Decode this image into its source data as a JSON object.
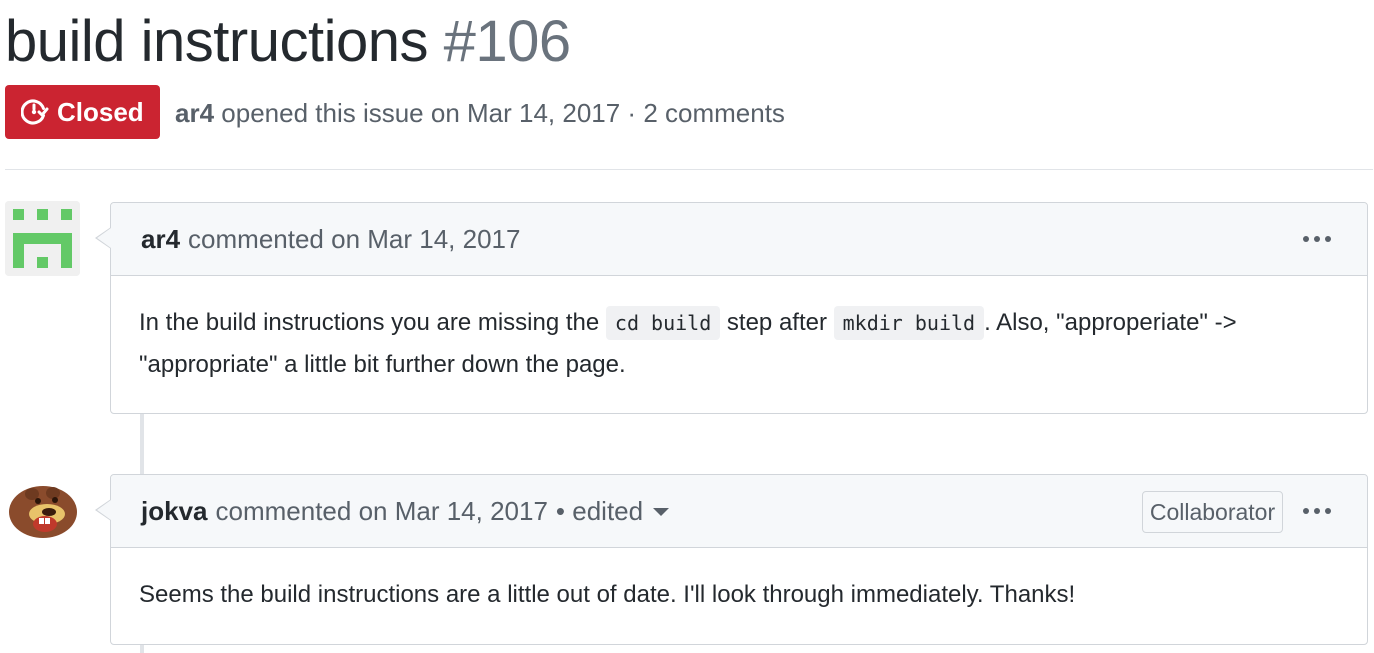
{
  "issue": {
    "title": "build instructions",
    "number": "#106",
    "state": "Closed",
    "state_color": "#cb2431",
    "opened_by": "ar4",
    "opened_text": " opened this issue on Mar 14, 2017 · 2 comments"
  },
  "comments": [
    {
      "author": "ar4",
      "when": "commented on Mar 14, 2017",
      "avatar_icon": "identicon",
      "avatar_color": "#63c967",
      "body": {
        "t1": "In the build instructions you are missing the ",
        "code1": "cd build",
        "t2": " step after ",
        "code2": "mkdir build",
        "t3": ". Also, \"approperiate\" -> \"appropriate\" a little bit further down the page."
      }
    },
    {
      "author": "jokva",
      "when": "commented on Mar 14, 2017",
      "edited": "• edited",
      "role": "Collaborator",
      "avatar_icon": "beaver-avatar",
      "body": {
        "text": "Seems the build instructions are a little out of date. I'll look through immediately. Thanks!"
      }
    }
  ]
}
